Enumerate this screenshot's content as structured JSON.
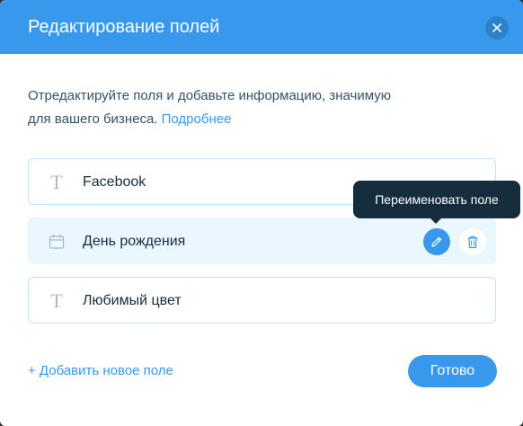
{
  "dialog": {
    "title": "Редактирование полей",
    "description": "Отредактируйте поля и добавьте информацию, значимую для вашего бизнеса.",
    "learn_more_link": "Подробнее"
  },
  "fields": [
    {
      "label": "Facebook",
      "icon": "text-icon"
    },
    {
      "label": "День рождения",
      "icon": "calendar-icon"
    },
    {
      "label": "Любимый цвет",
      "icon": "text-icon"
    }
  ],
  "tooltip": {
    "text": "Переименовать поле"
  },
  "footer": {
    "add_field_link": "+ Добавить новое поле",
    "done_button": "Готово"
  },
  "colors": {
    "accent": "#3899ec",
    "text_dark": "#162d3d",
    "text_secondary": "#32536a",
    "field_border": "#c1e4fe",
    "active_row_bg": "#eaf7ff",
    "tooltip_bg": "#162d3d"
  }
}
